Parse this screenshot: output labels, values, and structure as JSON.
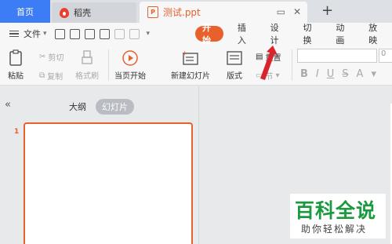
{
  "tabs": {
    "home": "首页",
    "docer": "稻壳",
    "document": "测试.ppt"
  },
  "menu": {
    "file": "文件",
    "tabs": [
      "开始",
      "插入",
      "设计",
      "切换",
      "动画",
      "放映"
    ]
  },
  "ribbon": {
    "paste": "粘贴",
    "cut": "剪切",
    "copy": "复制",
    "format_painter": "格式刷",
    "play_from_current": "当页开始",
    "new_slide": "新建幻灯片",
    "layout": "版式",
    "reset": "重置",
    "section": "节",
    "font_size": "0"
  },
  "panel": {
    "outline": "大纲",
    "slides": "幻灯片",
    "slide_number": "1"
  },
  "watermark": {
    "title": "百科全说",
    "subtitle": "助你轻松解决"
  },
  "colors": {
    "accent": "#e8602c",
    "home_tab": "#3c7cf5",
    "watermark_green": "#1a9a3e",
    "arrow_red": "#d9232d"
  }
}
